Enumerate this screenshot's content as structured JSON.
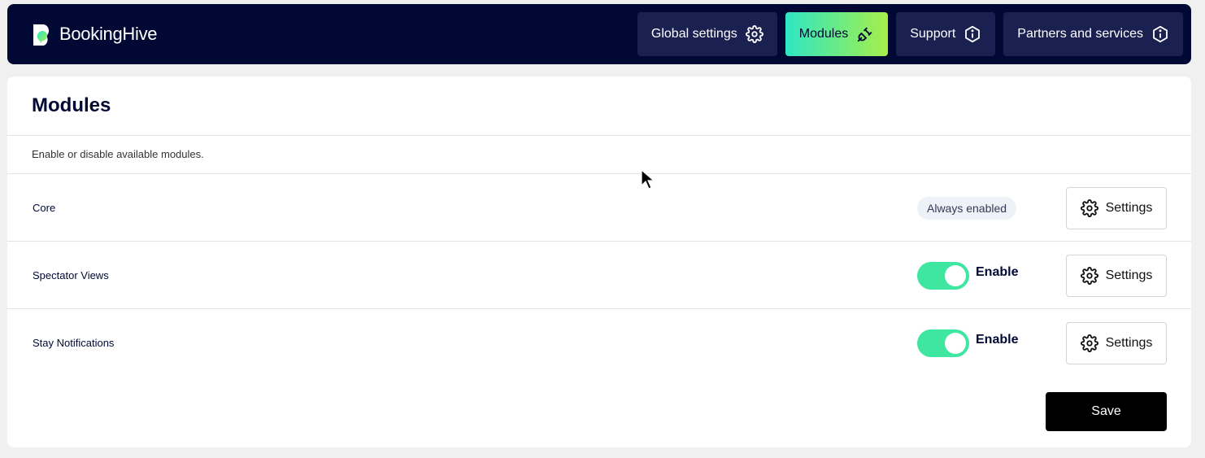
{
  "app": {
    "brand": "BookingHive"
  },
  "nav": {
    "items": [
      {
        "label": "Global settings",
        "icon": "gear-icon"
      },
      {
        "label": "Modules",
        "icon": "plug-icon",
        "active": true
      },
      {
        "label": "Support",
        "icon": "info-icon"
      },
      {
        "label": "Partners and services",
        "icon": "info-icon"
      }
    ]
  },
  "page": {
    "title": "Modules",
    "description": "Enable or disable available modules."
  },
  "modules": [
    {
      "name": "Core",
      "status": "Always enabled",
      "settings_label": "Settings"
    },
    {
      "name": "Spectator Views",
      "toggle_label": "Enable",
      "enabled": true,
      "settings_label": "Settings"
    },
    {
      "name": "Stay Notifications",
      "toggle_label": "Enable",
      "enabled": true,
      "settings_label": "Settings"
    }
  ],
  "actions": {
    "save_label": "Save"
  },
  "colors": {
    "header_bg": "#000833",
    "nav_btn_bg": "#1a2050",
    "accent_start": "#2ee6c3",
    "accent_end": "#a6ef4a",
    "toggle_on": "#3ee6a0"
  }
}
